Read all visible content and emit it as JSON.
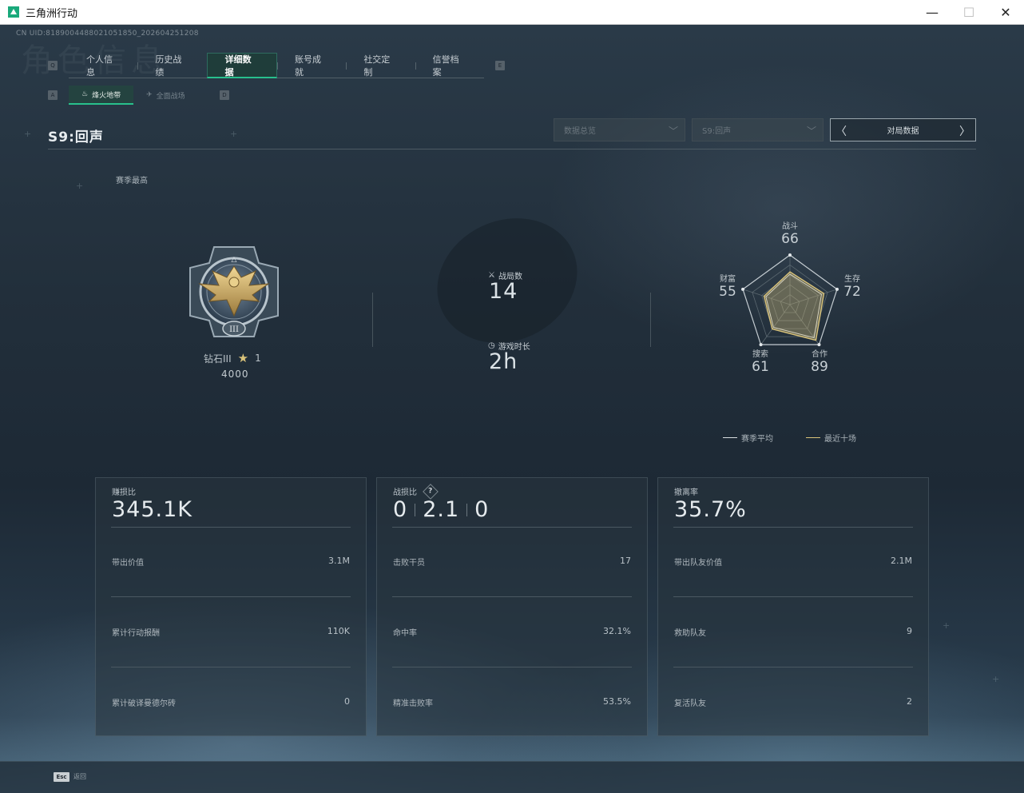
{
  "window": {
    "title": "三角洲行动",
    "min_glyph": "—",
    "max_glyph": "☐",
    "close_glyph": "✕"
  },
  "uid_text": "CN UID:8189004488021051850_202604251208",
  "watermark": "角色信息",
  "main_tabs": [
    "个人信息",
    "历史战绩",
    "详细数据",
    "账号成就",
    "社交定制",
    "信誉档案"
  ],
  "main_tabs_active": 2,
  "main_tabs_keys": {
    "left": "Q",
    "right": "E"
  },
  "sub_tabs": [
    {
      "label": "烽火地带",
      "icon": "flame-icon",
      "active": true
    },
    {
      "label": "全面战场",
      "icon": "plane-icon",
      "active": false
    }
  ],
  "sub_tabs_keys": {
    "left": "A",
    "right": "D"
  },
  "season_title": "S9:回声",
  "filters": {
    "data_type": "数据总览",
    "season": "S9:回声",
    "pager_label": "对局数据"
  },
  "season_best_label": "赛季最高",
  "rank": {
    "name": "钻石III",
    "stars": "1",
    "score": "4000",
    "medal_numeral": "III"
  },
  "stats": {
    "matches_label": "战局数",
    "matches_value": "14",
    "playtime_label": "游戏时长",
    "playtime_value": "2h"
  },
  "radar": {
    "axes": [
      {
        "label": "战斗",
        "value": 66
      },
      {
        "label": "生存",
        "value": 72
      },
      {
        "label": "合作",
        "value": 89
      },
      {
        "label": "搜索",
        "value": 61
      },
      {
        "label": "财富",
        "value": 55
      }
    ],
    "max": 100,
    "legend": [
      {
        "label": "赛季平均",
        "color": "#d8dde0"
      },
      {
        "label": "最近十场",
        "color": "#d9c37a"
      }
    ]
  },
  "panels": [
    {
      "title": "赚损比",
      "big": "345.1K",
      "rows": [
        {
          "label": "带出价值",
          "value": "3.1M"
        },
        {
          "label": "累计行动报酬",
          "value": "110K"
        },
        {
          "label": "累计破译曼德尔砖",
          "value": "0"
        }
      ]
    },
    {
      "title": "战损比",
      "big_parts": [
        "0",
        "2.1",
        "0"
      ],
      "help": "?",
      "rows": [
        {
          "label": "击败干员",
          "value": "17"
        },
        {
          "label": "命中率",
          "value": "32.1%"
        },
        {
          "label": "精准击败率",
          "value": "53.5%"
        }
      ]
    },
    {
      "title": "撤离率",
      "big": "35.7%",
      "rows": [
        {
          "label": "带出队友价值",
          "value": "2.1M"
        },
        {
          "label": "救助队友",
          "value": "9"
        },
        {
          "label": "复活队友",
          "value": "2"
        }
      ]
    }
  ],
  "footer": {
    "esc_key": "Esc",
    "esc_label": "返回"
  }
}
